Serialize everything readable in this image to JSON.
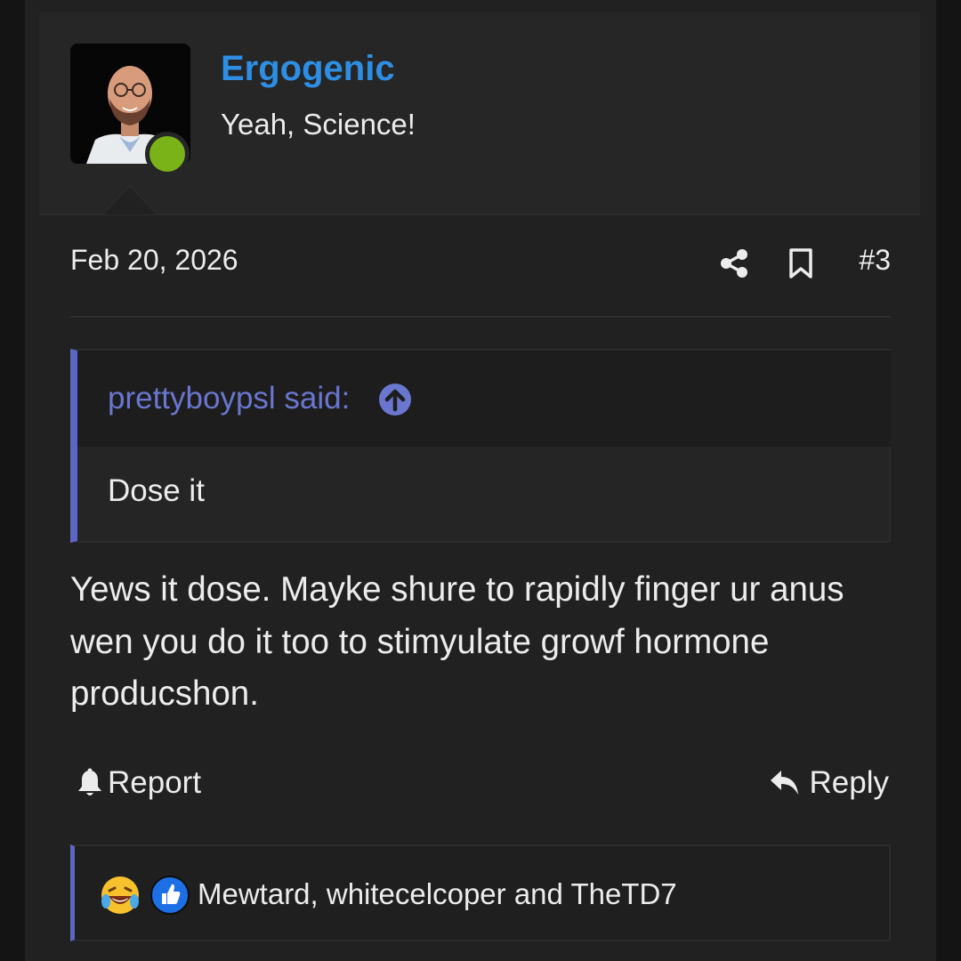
{
  "post": {
    "author": "Ergogenic",
    "user_title": "Yeah, Science!",
    "date": "Feb 20, 2026",
    "post_number": "#3",
    "online_status_color": "#7ab317",
    "username_color": "#2e8ee3"
  },
  "quote": {
    "author_label": "prettyboypsl said:",
    "text": "Dose it",
    "accent_color": "#5c67c4"
  },
  "message": {
    "text": "Yews it dose. Mayke shure to rapidly finger ur anus wen you do it too to stimyulate growf hormone producshon."
  },
  "actions": {
    "report_label": "Report",
    "reply_label": "Reply"
  },
  "reactions": {
    "icons": [
      "laughing-crying-emoji-icon",
      "thumbs-up-icon"
    ],
    "users_text": "Mewtard, whitecelcoper and TheTD7"
  },
  "icons": {
    "share": "share-icon",
    "bookmark": "bookmark-icon",
    "quote_jump": "arrow-up-circle-icon",
    "report": "bell-icon",
    "reply": "reply-arrow-icon"
  }
}
